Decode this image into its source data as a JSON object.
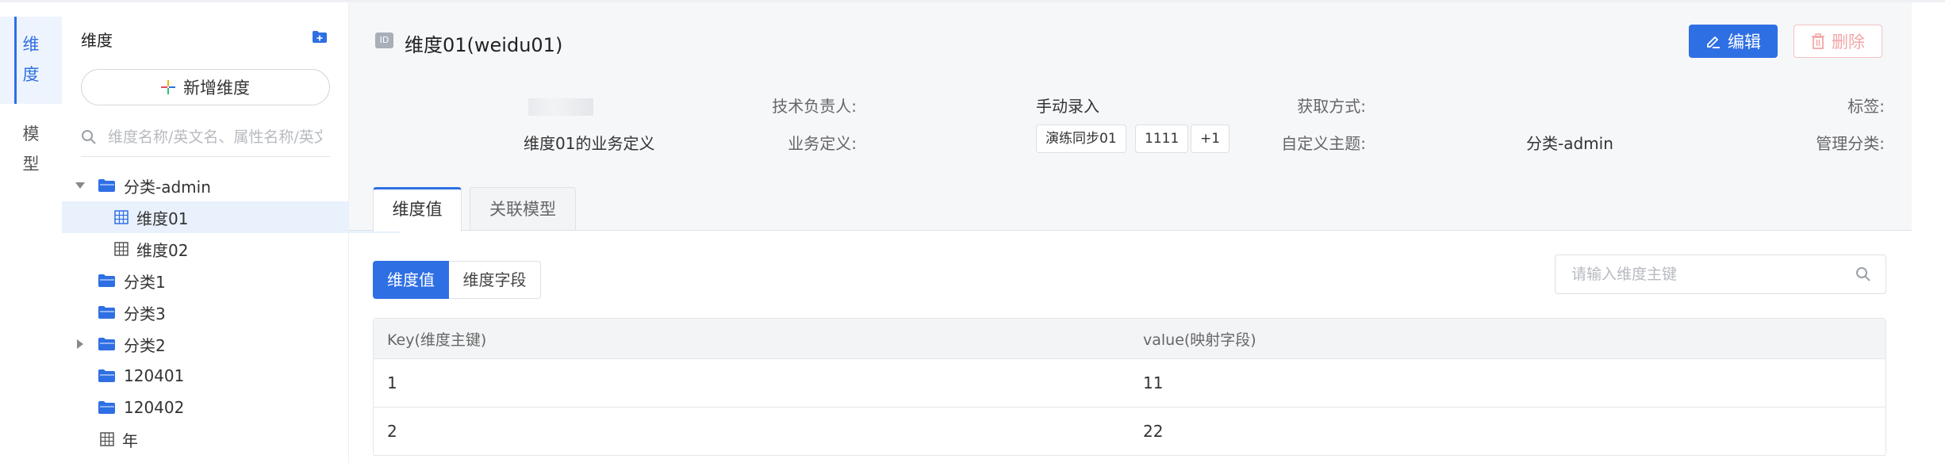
{
  "rail": {
    "tab_dimension": "维度",
    "tab_model": "模型"
  },
  "tree": {
    "title": "维度",
    "add_button": "新增维度",
    "search_placeholder": "维度名称/英文名、属性名称/英文名",
    "items": [
      {
        "label": "分类-admin",
        "type": "folder",
        "expanded": true
      },
      {
        "label": "维度01",
        "type": "table",
        "selected": true
      },
      {
        "label": "维度02",
        "type": "table"
      },
      {
        "label": "分类1",
        "type": "folder"
      },
      {
        "label": "分类3",
        "type": "folder"
      },
      {
        "label": "分类2",
        "type": "folder",
        "collapsed": true
      },
      {
        "label": "120401",
        "type": "folder"
      },
      {
        "label": "120402",
        "type": "folder"
      },
      {
        "label": "年",
        "type": "table"
      }
    ]
  },
  "header": {
    "id_badge": "ID",
    "title": "维度01(weidu01)",
    "edit_label": "编辑",
    "delete_label": "删除",
    "fields": {
      "tech_owner_label": "技术负责人:",
      "acquire_label": "获取方式:",
      "acquire_value": "手动录入",
      "tags_label": "标签:",
      "biz_def_label": "业务定义:",
      "biz_def_value": "维度01的业务定义",
      "custom_topic_label": "自定义主题:",
      "custom_topics": [
        "演练同步01",
        "1111",
        "+1"
      ],
      "mgmt_cat_label": "管理分类:",
      "mgmt_cat_value": "分类-admin"
    }
  },
  "tabs": [
    "维度值",
    "关联模型"
  ],
  "segments": [
    "维度值",
    "维度字段"
  ],
  "key_search_placeholder": "请输入维度主键",
  "table": {
    "columns": [
      "Key(维度主键)",
      "value(映射字段)"
    ],
    "rows": [
      [
        "1",
        "11"
      ],
      [
        "2",
        "22"
      ]
    ]
  },
  "colors": {
    "accent": "#2f6fe4",
    "danger": "#f2a7a7",
    "folder": "#2f6fe4"
  }
}
